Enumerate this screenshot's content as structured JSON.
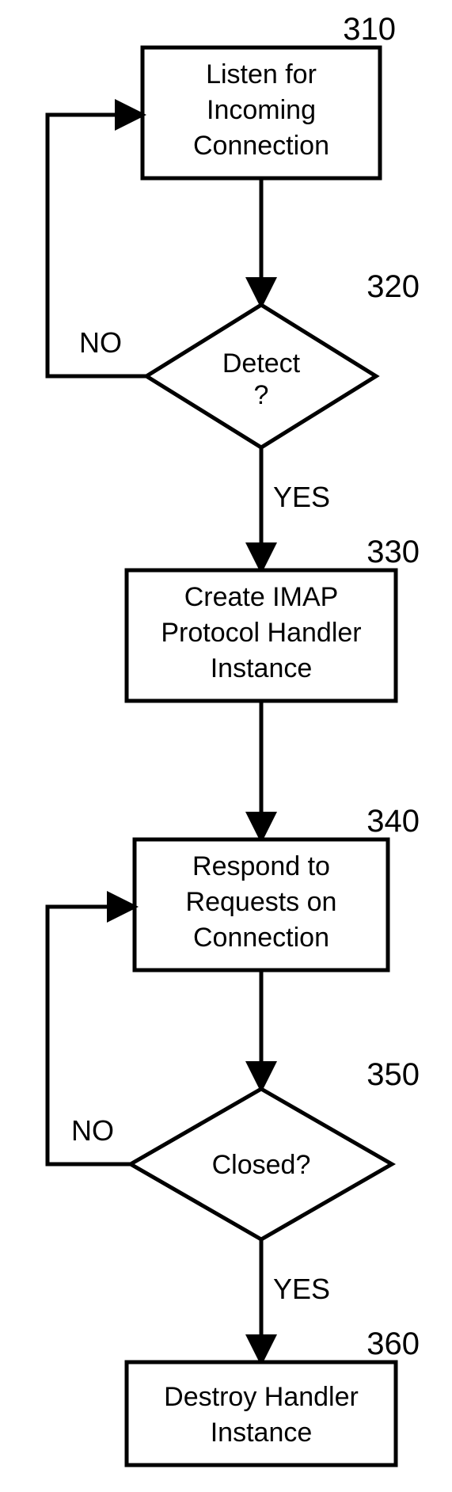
{
  "nodes": {
    "n310": {
      "ref": "310",
      "lines": [
        "Listen for",
        "Incoming",
        "Connection"
      ]
    },
    "n320": {
      "ref": "320",
      "lines": [
        "Detect",
        "?"
      ]
    },
    "n330": {
      "ref": "330",
      "lines": [
        "Create IMAP",
        "Protocol Handler",
        "Instance"
      ]
    },
    "n340": {
      "ref": "340",
      "lines": [
        "Respond to",
        "Requests on",
        "Connection"
      ]
    },
    "n350": {
      "ref": "350",
      "lines": [
        "Closed?"
      ]
    },
    "n360": {
      "ref": "360",
      "lines": [
        "Destroy Handler",
        "Instance"
      ]
    }
  },
  "edges": {
    "e320_no": {
      "label": "NO"
    },
    "e320_yes": {
      "label": "YES"
    },
    "e350_no": {
      "label": "NO"
    },
    "e350_yes": {
      "label": "YES"
    }
  }
}
